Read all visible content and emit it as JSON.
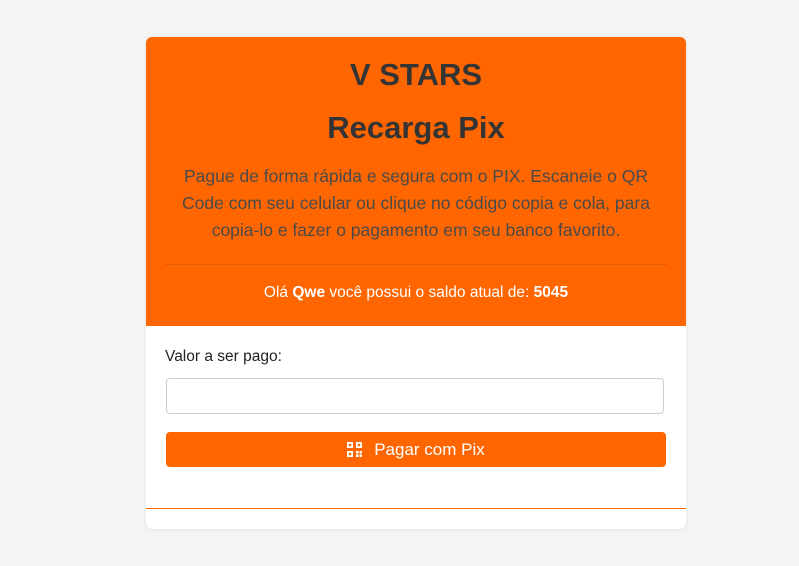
{
  "header": {
    "brand": "V STARS",
    "title": "Recarga Pix",
    "description": "Pague de forma rápida e segura com o PIX. Escaneie o QR Code com seu celular ou clique no código copia e cola, para copia-lo e fazer o pagamento em seu banco favorito.",
    "balance": {
      "prefix": "Olá ",
      "user": "Qwe",
      "middle": " você possui o saldo atual de: ",
      "amount": "5045"
    }
  },
  "form": {
    "amount_label": "Valor a ser pago:",
    "amount_value": "",
    "amount_placeholder": "",
    "pay_button_label": "Pagar com Pix",
    "pay_button_icon": "qr-code-icon"
  },
  "colors": {
    "accent": "#ff6600",
    "background": "#f4f4f4",
    "card": "#ffffff"
  }
}
